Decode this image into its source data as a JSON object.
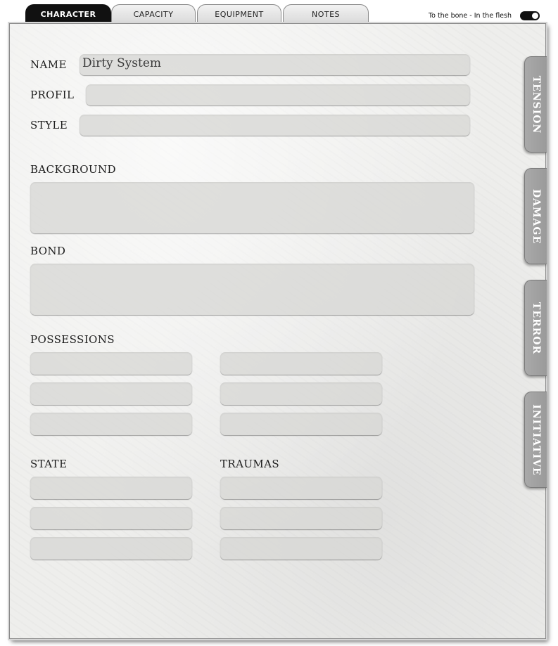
{
  "tabs": [
    {
      "label": "CHARACTER",
      "active": true
    },
    {
      "label": "CAPACITY",
      "active": false
    },
    {
      "label": "EQUIPMENT",
      "active": false
    },
    {
      "label": "NOTES",
      "active": false
    }
  ],
  "toggle": {
    "label": "To the bone - In the flesh",
    "on": true
  },
  "fields": {
    "name": {
      "label": "NAME",
      "value": "Dirty System"
    },
    "profil": {
      "label": "PROFIL",
      "value": ""
    },
    "style": {
      "label": "STYLE",
      "value": ""
    },
    "background": {
      "label": "BACKGROUND",
      "value": ""
    },
    "bond": {
      "label": "BOND",
      "value": ""
    }
  },
  "sections": {
    "possessions": "POSSESSIONS",
    "state": "STATE",
    "traumas": "TRAUMAS"
  },
  "side_tabs": [
    "TENSION",
    "DAMAGE",
    "TERROR",
    "INITIATIVE"
  ],
  "colors": {
    "active_tab": "#111111",
    "field": "#d7d7d5",
    "side_tab": "#9d9d9d"
  }
}
